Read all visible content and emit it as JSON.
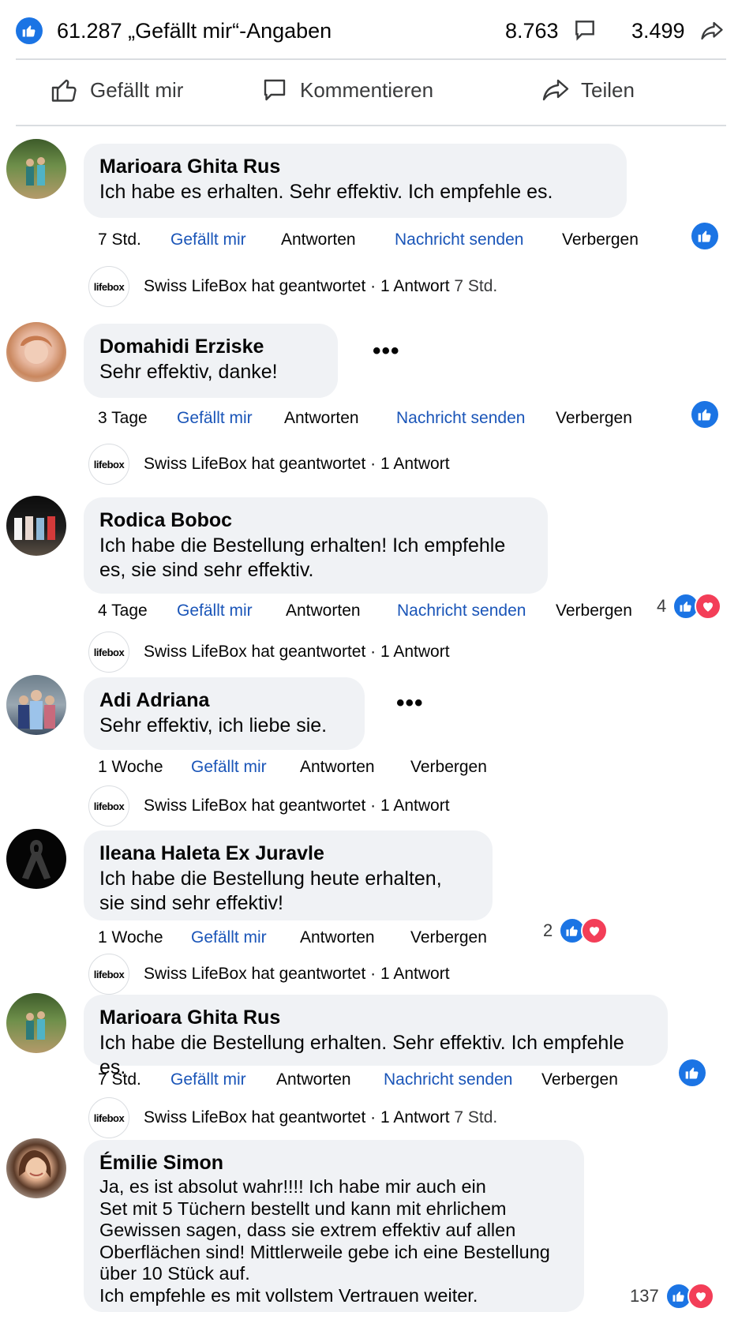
{
  "header": {
    "likes": "61.287 „Gefällt mir“-Angaben",
    "comments": "8.763",
    "shares": "3.499"
  },
  "actions": {
    "like": "Gefällt mir",
    "comment": "Kommentieren",
    "share": "Teilen"
  },
  "comments": [
    {
      "name": "Marioara Ghita Rus",
      "text": "Ich habe es erhalten. Sehr effektiv. Ich empfehle es.",
      "time": "7 Std.",
      "like": "Gefällt mir",
      "reply": "Antworten",
      "message": "Nachricht senden",
      "hide": "Verbergen",
      "reply_summary": "Swiss LifeBox hat geantwortet · 1 Antwort",
      "reply_time": "7 Std."
    },
    {
      "name": "Domahidi Erziske",
      "text": "Sehr effektiv, danke!",
      "time": "3 Tage",
      "like": "Gefällt mir",
      "reply": "Antworten",
      "message": "Nachricht senden",
      "hide": "Verbergen",
      "reply_summary": "Swiss LifeBox hat geantwortet · 1 Antwort"
    },
    {
      "name": "Rodica Boboc",
      "text": "Ich habe die Bestellung erhalten! Ich empfehle\nes, sie sind sehr effektiv.",
      "time": "4 Tage",
      "like": "Gefällt mir",
      "reply": "Antworten",
      "message": "Nachricht senden",
      "hide": "Verbergen",
      "reactions": "4",
      "reply_summary": "Swiss LifeBox hat geantwortet · 1 Antwort"
    },
    {
      "name": "Adi Adriana",
      "text": "Sehr effektiv, ich liebe sie.",
      "time": "1 Woche",
      "like": "Gefällt mir",
      "reply": "Antworten",
      "hide": "Verbergen",
      "reply_summary": "Swiss LifeBox hat geantwortet · 1 Antwort"
    },
    {
      "name": "Ileana Haleta Ex Juravle",
      "text": "Ich habe die Bestellung heute erhalten,\nsie sind sehr effektiv!",
      "time": "1 Woche",
      "like": "Gefällt mir",
      "reply": "Antworten",
      "hide": "Verbergen",
      "reactions": "2",
      "reply_summary": "Swiss LifeBox hat geantwortet · 1 Antwort"
    },
    {
      "name": "Marioara Ghita Rus",
      "text": "Ich habe die Bestellung erhalten. Sehr effektiv. Ich empfehle es.",
      "time": "7 Std.",
      "like": "Gefällt mir",
      "reply": "Antworten",
      "message": "Nachricht senden",
      "hide": "Verbergen",
      "reply_summary": "Swiss LifeBox hat geantwortet · 1 Antwort",
      "reply_time": "7 Std."
    },
    {
      "name": "Émilie Simon",
      "text": "Ja, es ist absolut wahr!!!! Ich habe mir auch ein\nSet mit 5 Tüchern bestellt und kann mit ehrlichem\nGewissen sagen, dass sie extrem effektiv auf allen\nOberflächen sind! Mittlerweile gebe ich eine Bestellung\nüber 10 Stück auf.\nIch empfehle es mit vollstem Vertrauen weiter.",
      "reactions": "137"
    }
  ],
  "reply_logo": "lifebox",
  "colors": {
    "like_blue": "#1b74e4",
    "love_red": "#f33e58",
    "link_blue": "#1a55b8",
    "bubble_bg": "#f0f2f5"
  }
}
